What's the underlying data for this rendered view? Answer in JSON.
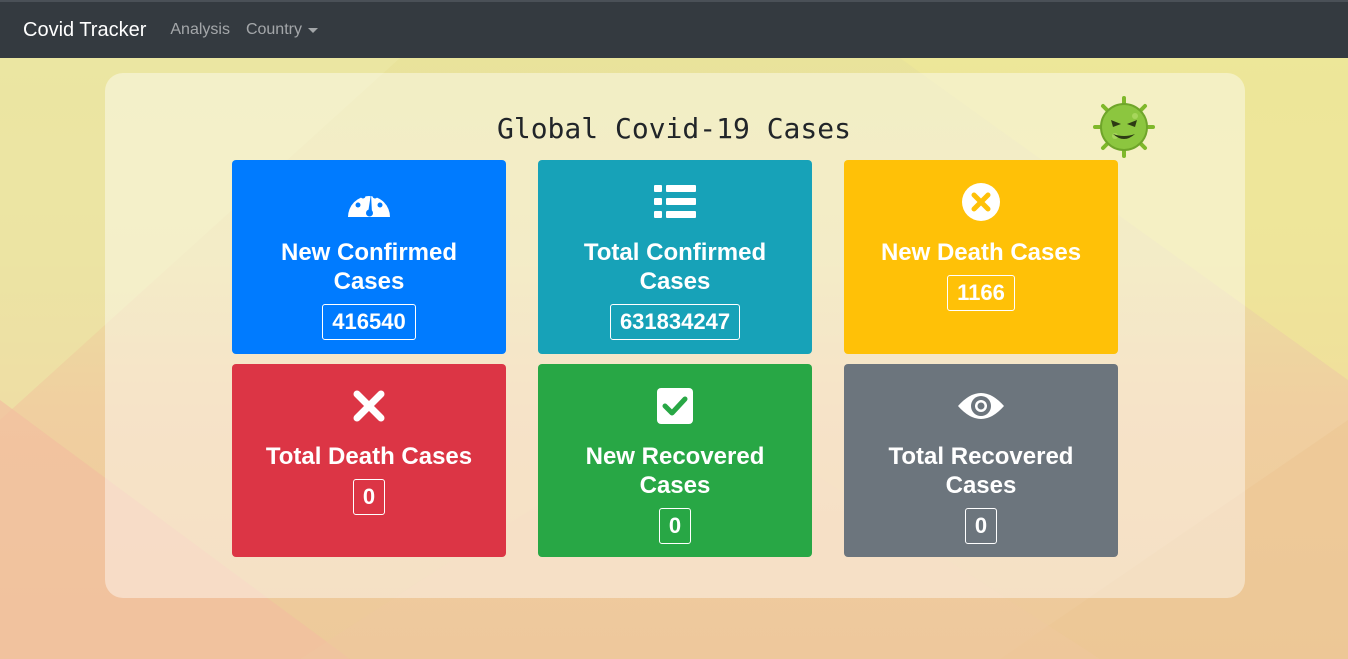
{
  "navbar": {
    "brand": "Covid Tracker",
    "links": [
      {
        "label": "Analysis"
      },
      {
        "label": "Country"
      }
    ]
  },
  "main": {
    "title": "Global Covid-19 Cases",
    "cards": [
      {
        "label": "New Confirmed Cases",
        "value": "416540",
        "icon": "tachometer-icon",
        "color": "#007bff"
      },
      {
        "label": "Total Confirmed Cases",
        "value": "631834247",
        "icon": "list-icon",
        "color": "#17a2b8"
      },
      {
        "label": "New Death Cases",
        "value": "1166",
        "icon": "times-circle-icon",
        "color": "#ffc107"
      },
      {
        "label": "Total Death Cases",
        "value": "0",
        "icon": "times-icon",
        "color": "#dc3545"
      },
      {
        "label": "New Recovered Cases",
        "value": "0",
        "icon": "check-square-icon",
        "color": "#28a745"
      },
      {
        "label": "Total Recovered Cases",
        "value": "0",
        "icon": "eye-icon",
        "color": "#6c757d"
      }
    ]
  }
}
